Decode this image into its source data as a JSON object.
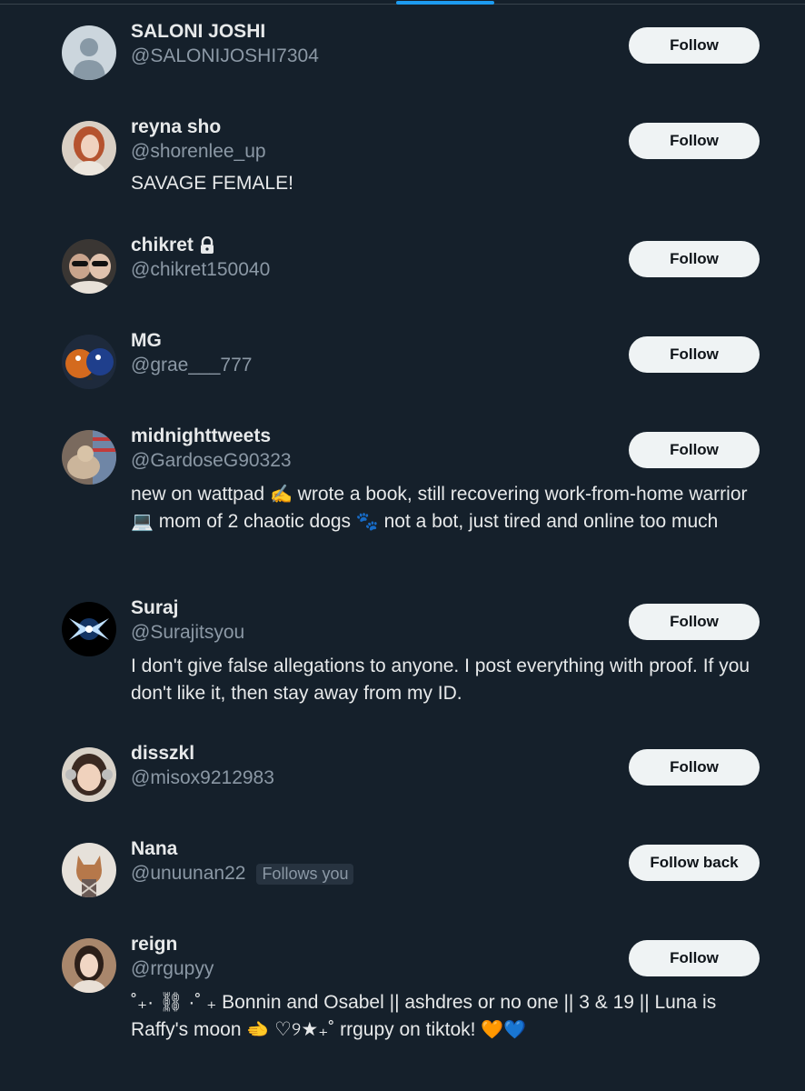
{
  "accounts": [
    {
      "name": "SALONI JOSHI",
      "handle": "@SALONIJOSHI7304",
      "bio": "",
      "button": "Follow"
    },
    {
      "name": "reyna sho",
      "handle": "@shorenlee_up",
      "bio": "SAVAGE FEMALE!",
      "button": "Follow"
    },
    {
      "name": "chikret",
      "handle": "@chikret150040",
      "bio": "",
      "button": "Follow",
      "protected_icon": "lock-icon"
    },
    {
      "name": "MG",
      "handle": "@grae___777",
      "bio": "",
      "button": "Follow"
    },
    {
      "name": "midnighttweets",
      "handle": "@GardoseG90323",
      "bio_parts": [
        "new on wattpad ",
        "✍️",
        " wrote a book, still recovering work-from-home warrior ",
        "💻",
        " mom of 2 chaotic dogs ",
        "🐾",
        " not a bot, just tired and online too much"
      ],
      "button": "Follow"
    },
    {
      "name": "Suraj",
      "handle": "@Surajitsyou",
      "bio": "I don't give false allegations to anyone. I post everything with proof. If you don't like it, then stay away from my ID.",
      "button": "Follow"
    },
    {
      "name": "disszkl",
      "handle": "@misox9212983",
      "bio": "",
      "button": "Follow"
    },
    {
      "name": "Nana",
      "handle": "@unuunan22",
      "badge": "Follows you",
      "bio": "",
      "button": "Follow back"
    },
    {
      "name": "reign",
      "handle": "@rrgupyy",
      "bio_parts": [
        "˚₊· ⛓ ·˚ ₊ Bonnin and Osabel || ashdres or no one || 3 & 19 || Luna is Raffy's moon ",
        "🫲",
        " ♡୨★₊˚ rrgupy on tiktok! ",
        "🧡",
        "💙"
      ],
      "button": "Follow"
    }
  ],
  "colors": {
    "background": "#15202b",
    "accent": "#1d9bf0",
    "text_primary": "#e7e9ea",
    "text_secondary": "#8b98a5",
    "button_bg": "#eff3f4"
  }
}
